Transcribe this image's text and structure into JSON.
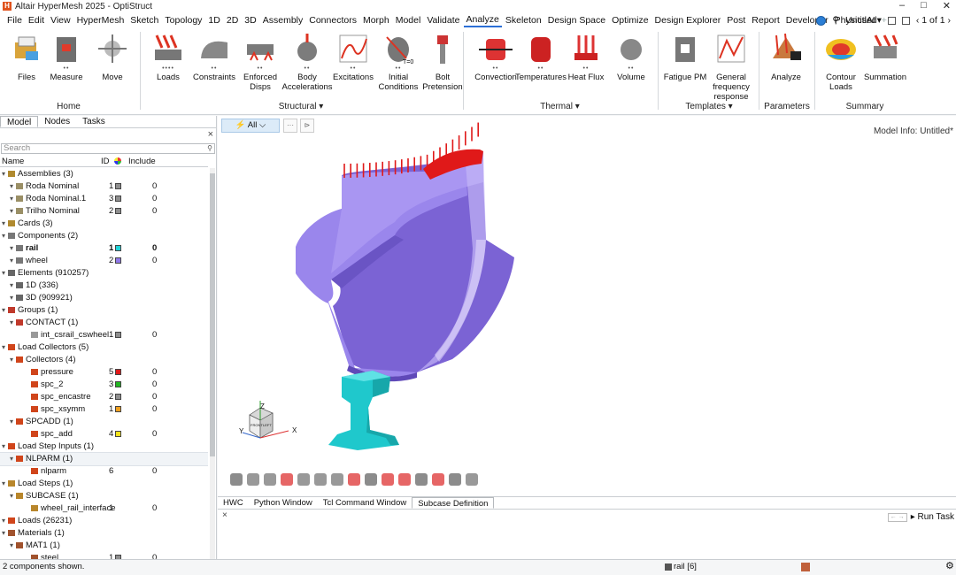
{
  "window": {
    "title": "Altair HyperMesh 2025 - OptiStruct",
    "controls": [
      "–",
      "□",
      "✕"
    ]
  },
  "menubar": {
    "items": [
      "File",
      "Edit",
      "View",
      "HyperMesh",
      "Sketch",
      "Topology",
      "1D",
      "2D",
      "3D",
      "Assembly",
      "Connectors",
      "Morph",
      "Model",
      "Validate",
      "Analyze",
      "Skeleton",
      "Design Space",
      "Optimize",
      "Design Explorer",
      "Post",
      "Report",
      "Developer",
      "PhysicsAI"
    ],
    "active": "Analyze",
    "plus": "+",
    "right": {
      "doc": "Untitled▾",
      "pages": "‹ 1 of 1 ›"
    }
  },
  "ribbon": {
    "tools": [
      {
        "label": "Files",
        "dots": ""
      },
      {
        "label": "Measure",
        "dots": "••"
      },
      {
        "label": "Move",
        "dots": ""
      },
      {
        "label": "Loads",
        "dots": "••••"
      },
      {
        "label": "Constraints",
        "dots": "••"
      },
      {
        "label": "Enforced Disps",
        "dots": "••"
      },
      {
        "label": "Body Accelerations",
        "dots": "••"
      },
      {
        "label": "Excitations",
        "dots": "••"
      },
      {
        "label": "Initial Conditions",
        "dots": "••"
      },
      {
        "label": "Bolt Pretension",
        "dots": ""
      },
      {
        "label": "Convection",
        "dots": "••"
      },
      {
        "label": "Temperatures",
        "dots": "••"
      },
      {
        "label": "Heat Flux",
        "dots": "••"
      },
      {
        "label": "Volume",
        "dots": "••"
      },
      {
        "label": "Fatigue PM",
        "dots": ""
      },
      {
        "label": "General frequency response",
        "dots": ""
      },
      {
        "label": "Analyze",
        "dots": ""
      },
      {
        "label": "Contour Loads",
        "dots": ""
      },
      {
        "label": "Summation",
        "dots": ""
      }
    ],
    "groups": {
      "home": "Home",
      "structural": "Structural ▾",
      "thermal": "Thermal ▾",
      "templates": "Templates ▾",
      "parameters": "Parameters",
      "summary": "Summary"
    }
  },
  "left_panel": {
    "tabs": [
      "Model",
      "Nodes",
      "Tasks"
    ],
    "active_tab": "Model",
    "search_placeholder": "Search",
    "columns": {
      "name": "Name",
      "id": "ID",
      "include": "Include"
    },
    "rows": [
      {
        "level": 0,
        "name": "Assemblies (3)",
        "icon": "assembly-icon",
        "color": "#b08a2f"
      },
      {
        "level": 1,
        "name": "Roda Nominal",
        "id": "1",
        "swatch": "#8e8e8e",
        "include": "0",
        "icon": "part-icon",
        "color": "#9a8f66"
      },
      {
        "level": 1,
        "name": "Roda Nominal.1",
        "id": "3",
        "swatch": "#8e8e8e",
        "include": "0",
        "icon": "part-icon",
        "color": "#9a8f66"
      },
      {
        "level": 1,
        "name": "Trilho Nominal",
        "id": "2",
        "swatch": "#8e8e8e",
        "include": "0",
        "icon": "part-icon",
        "color": "#9a8f66"
      },
      {
        "level": 0,
        "name": "Cards (3)",
        "icon": "card-icon",
        "color": "#b08a2f"
      },
      {
        "level": 0,
        "name": "Components (2)",
        "icon": "component-icon",
        "color": "#777777"
      },
      {
        "level": 1,
        "name": "rail",
        "id": "1",
        "swatch": "#1fd3d8",
        "include": "0",
        "bold": true,
        "icon": "component-icon",
        "color": "#777777"
      },
      {
        "level": 1,
        "name": "wheel",
        "id": "2",
        "swatch": "#8f78e8",
        "include": "0",
        "icon": "component-icon",
        "color": "#777777"
      },
      {
        "level": 0,
        "name": "Elements (910257)",
        "icon": "element-icon",
        "color": "#666666"
      },
      {
        "level": 1,
        "name": "1D (336)",
        "icon": "element-icon",
        "color": "#666666"
      },
      {
        "level": 1,
        "name": "3D (909921)",
        "icon": "element-icon",
        "color": "#666666"
      },
      {
        "level": 0,
        "name": "Groups (1)",
        "icon": "group-icon",
        "color": "#c0392b"
      },
      {
        "level": 1,
        "name": "CONTACT (1)",
        "icon": "group-icon",
        "color": "#c0392b"
      },
      {
        "level": 2,
        "name": "int_csrail_cswheel",
        "id": "1",
        "swatch": "#8e8e8e",
        "include": "0",
        "icon": "contact-icon",
        "color": "#999999"
      },
      {
        "level": 0,
        "name": "Load Collectors (5)",
        "icon": "loadcol-icon",
        "color": "#d0451b"
      },
      {
        "level": 1,
        "name": "Collectors (4)",
        "icon": "loadcol-icon",
        "color": "#d0451b"
      },
      {
        "level": 2,
        "name": "pressure",
        "id": "5",
        "swatch": "#e01919",
        "include": "0",
        "icon": "loadcol-icon",
        "color": "#d0451b"
      },
      {
        "level": 2,
        "name": "spc_2",
        "id": "3",
        "swatch": "#22b522",
        "include": "0",
        "icon": "loadcol-icon",
        "color": "#d0451b"
      },
      {
        "level": 2,
        "name": "spc_encastre",
        "id": "2",
        "swatch": "#8e8e8e",
        "include": "0",
        "icon": "loadcol-icon",
        "color": "#d0451b"
      },
      {
        "level": 2,
        "name": "spc_xsymm",
        "id": "1",
        "swatch": "#f0a020",
        "include": "0",
        "icon": "loadcol-icon",
        "color": "#d0451b"
      },
      {
        "level": 1,
        "name": "SPCADD (1)",
        "icon": "loadcol-icon",
        "color": "#d0451b"
      },
      {
        "level": 2,
        "name": "spc_add",
        "id": "4",
        "swatch": "#f2e21a",
        "include": "0",
        "icon": "loadcol-icon",
        "color": "#d0451b"
      },
      {
        "level": 0,
        "name": "Load Step Inputs (1)",
        "icon": "loadcol-icon",
        "color": "#d0451b"
      },
      {
        "level": 1,
        "name": "NLPARM (1)",
        "highlight": true,
        "icon": "loadcol-icon",
        "color": "#d0451b"
      },
      {
        "level": 2,
        "name": "nlparm",
        "id": "6",
        "include": "0",
        "icon": "loadcol-icon",
        "color": "#d0451b"
      },
      {
        "level": 0,
        "name": "Load Steps (1)",
        "icon": "loadstep-icon",
        "color": "#b8862b"
      },
      {
        "level": 1,
        "name": "SUBCASE (1)",
        "icon": "loadstep-icon",
        "color": "#b8862b"
      },
      {
        "level": 2,
        "name": "wheel_rail_interface",
        "id": "1",
        "include": "0",
        "icon": "loadstep-icon",
        "color": "#b8862b"
      },
      {
        "level": 0,
        "name": "Loads (26231)",
        "icon": "load-icon",
        "color": "#d0451b"
      },
      {
        "level": 0,
        "name": "Materials (1)",
        "icon": "material-icon",
        "color": "#a0522d"
      },
      {
        "level": 1,
        "name": "MAT1 (1)",
        "icon": "material-icon",
        "color": "#a0522d"
      },
      {
        "level": 2,
        "name": "steel",
        "id": "1",
        "swatch": "#8e8e8e",
        "include": "0",
        "icon": "material-icon",
        "color": "#a0522d"
      }
    ]
  },
  "viewport": {
    "filter_label": "⚡ All ⌵",
    "model_info": "Model Info: Untitled*",
    "triad": {
      "x": "X",
      "y": "Y",
      "z": "Z",
      "front": "FRONT",
      "left": "LEFT"
    }
  },
  "console": {
    "tabs": [
      "HWC",
      "Python Window",
      "Tcl Command Window",
      "Subcase Definition"
    ],
    "active_tab": "Subcase Definition",
    "run_task": "▸ Run Task"
  },
  "statusbar": {
    "left": "2 components shown.",
    "center": "rail [6]"
  },
  "colors": {
    "accent": "#2c6fd6",
    "wheel": "#8f78e8",
    "rail": "#1fd3d8",
    "load": "#e01919"
  }
}
